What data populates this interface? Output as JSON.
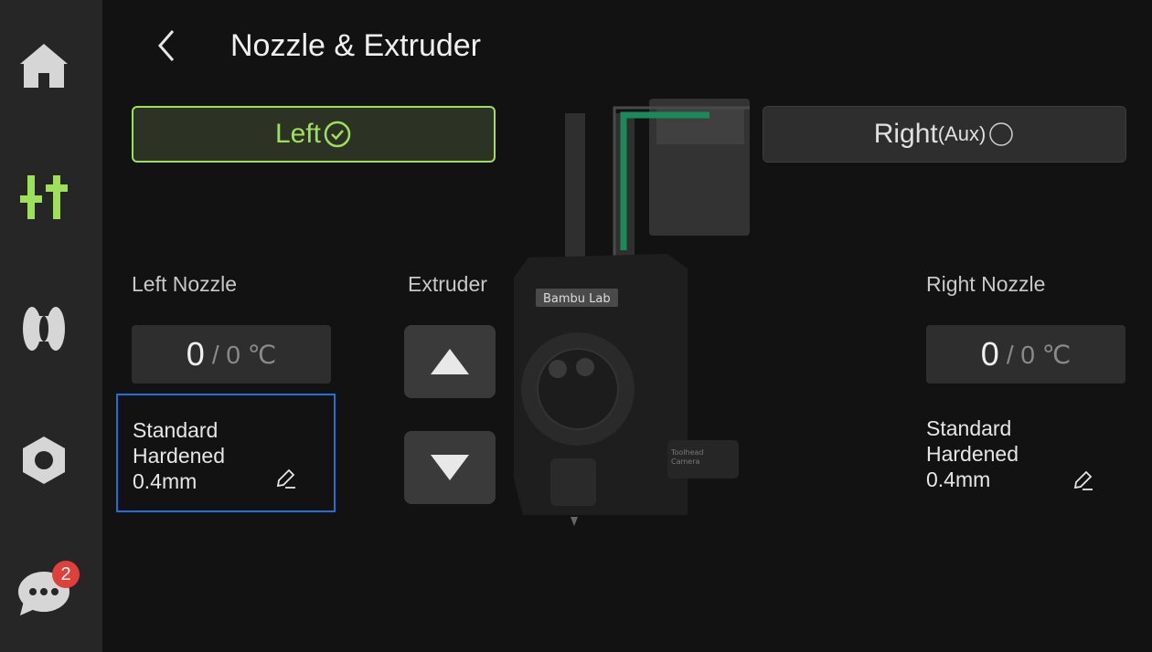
{
  "sidebar": {
    "items": [
      {
        "name": "home",
        "icon": "home-icon",
        "active": false
      },
      {
        "name": "controls",
        "icon": "sliders-icon",
        "active": true
      },
      {
        "name": "filament",
        "icon": "filament-spool-icon",
        "active": false
      },
      {
        "name": "settings",
        "icon": "hex-settings-icon",
        "active": false
      },
      {
        "name": "messages",
        "icon": "chat-bubble-icon",
        "active": false,
        "badge": "2"
      }
    ]
  },
  "header": {
    "title": "Nozzle & Extruder",
    "back_icon": "chevron-left-icon"
  },
  "selector": {
    "left_label": "Left",
    "left_icon": "check-circle-icon",
    "right_label": "Right",
    "right_suffix": "(Aux)",
    "right_icon": "empty-circle-icon",
    "active": "left"
  },
  "left_nozzle": {
    "label": "Left Nozzle",
    "current": "0",
    "target": "/ 0 ℃",
    "type_line1": "Standard",
    "type_line2": "Hardened",
    "size": "0.4mm",
    "edit_icon": "pencil-icon"
  },
  "extruder": {
    "label": "Extruder",
    "up_icon": "triangle-up-icon",
    "down_icon": "triangle-down-icon"
  },
  "right_nozzle": {
    "label": "Right Nozzle",
    "current": "0",
    "target": "/ 0 ℃",
    "type_line1": "Standard",
    "type_line2": "Hardened",
    "size": "0.4mm",
    "edit_icon": "pencil-icon"
  },
  "printhead": {
    "brand": "Bambu Lab",
    "camera_label_1": "Toolhead",
    "camera_label_2": "Camera"
  },
  "colors": {
    "accent": "#9fe05a",
    "selection": "#1e6ee0",
    "badge": "#e0403a",
    "filament_path": "#1b8a5a"
  }
}
